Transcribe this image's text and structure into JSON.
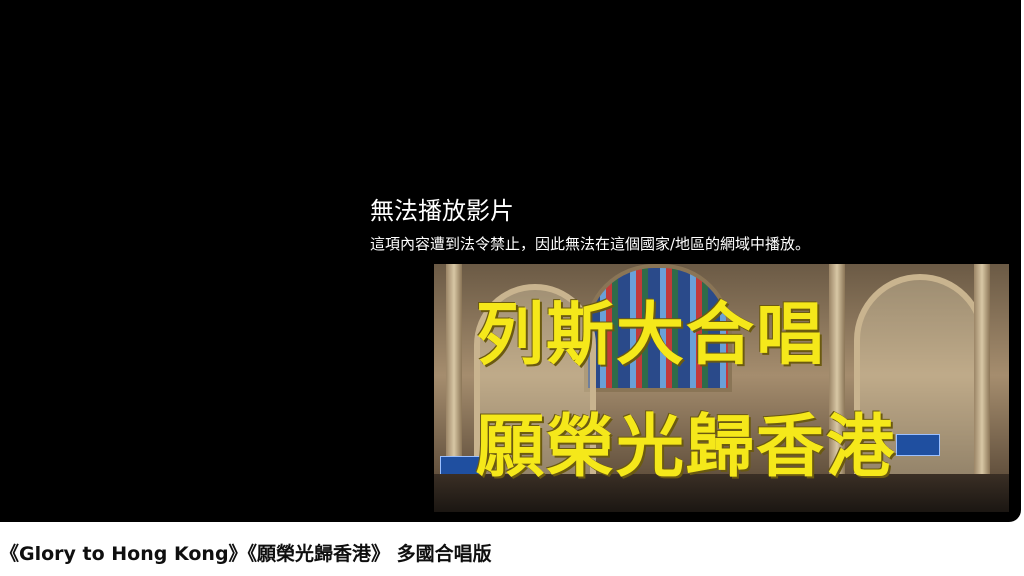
{
  "player": {
    "error_title": "無法播放影片",
    "error_message": "這項內容遭到法令禁止，因此無法在這個國家/地區的網域中播放。",
    "thumbnail": {
      "overlay_line_1": "列斯大合唱",
      "overlay_line_2": "願榮光歸香港"
    }
  },
  "video": {
    "title": "《Glory to Hong Kong》《願榮光歸香港》 多國合唱版"
  }
}
